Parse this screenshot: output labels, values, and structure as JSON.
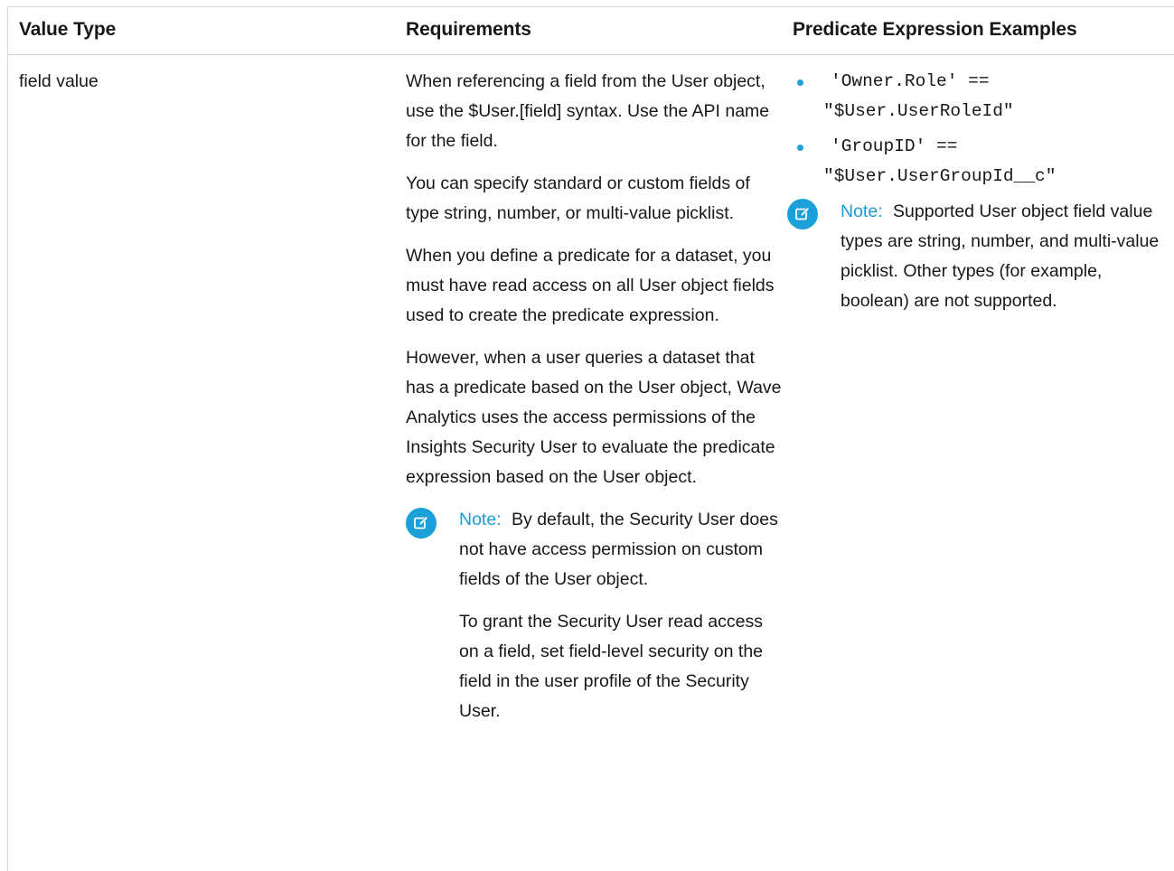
{
  "table": {
    "headers": {
      "value_type": "Value Type",
      "requirements": "Requirements",
      "examples": "Predicate Expression Examples"
    },
    "row": {
      "value_type": "field value",
      "requirements": {
        "paragraphs": [
          "When referencing a field from the User object, use the $User.[field] syntax. Use the API name for the field.",
          "You can specify standard or custom fields of type string, number, or multi-value picklist.",
          "When you define a predicate for a dataset, you must have read access on all User object fields used to create the predicate expression.",
          "However, when a user queries a dataset that has a predicate based on the User object, Wave Analytics uses the access permissions of the Insights Security User to evaluate the predicate expression based on the User object."
        ],
        "note": {
          "label": "Note:",
          "text": "By default, the Security User does not have access permission on custom fields of the User object.",
          "text2": "To grant the Security User read access on a field, set field-level security on the field in the user profile of the Security User."
        }
      },
      "examples": {
        "items": [
          {
            "line1": "'Owner.Role' ==",
            "line2": "\"$User.UserRoleId\""
          },
          {
            "line1": "'GroupID' ==",
            "line2": "\"$User.UserGroupId__c\""
          }
        ],
        "note": {
          "label": "Note:",
          "text": "Supported User object field value types are string, number, and multi-value picklist. Other types (for example, boolean) are not supported."
        }
      }
    }
  },
  "colors": {
    "accent": "#1ba1d8",
    "text": "#181818",
    "border": "#d8d8d8"
  },
  "icons": {
    "note": "edit-note-icon",
    "bullet": "bullet-dot"
  }
}
